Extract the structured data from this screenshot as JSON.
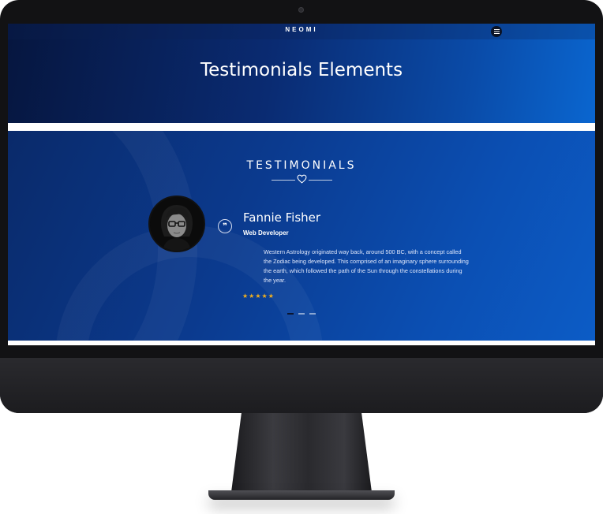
{
  "site": {
    "logo": "NEOMI",
    "menu_icon": "hamburger-icon"
  },
  "hero": {
    "title": "Testimonials Elements"
  },
  "testimonials": {
    "title": "TESTIMONIALS",
    "divider_icon": "heart-icon",
    "item": {
      "name": "Fannie Fisher",
      "role": "Web Developer",
      "quote_icon": "quote-icon",
      "text": "Western Astrology originated way back, around 500 BC, with a concept called the Zodiac being developed. This comprised of an imaginary sphere surrounding the earth, which followed the path of the Sun through the constellations during the year.",
      "stars": "★★★★★",
      "rating": 5
    },
    "pagination": {
      "count": 3,
      "active": 1
    }
  },
  "colors": {
    "hero_gradient_start": "#06163f",
    "hero_gradient_end": "#0a66d0",
    "star": "#f2b01e",
    "monitor_bezel": "#121214"
  }
}
